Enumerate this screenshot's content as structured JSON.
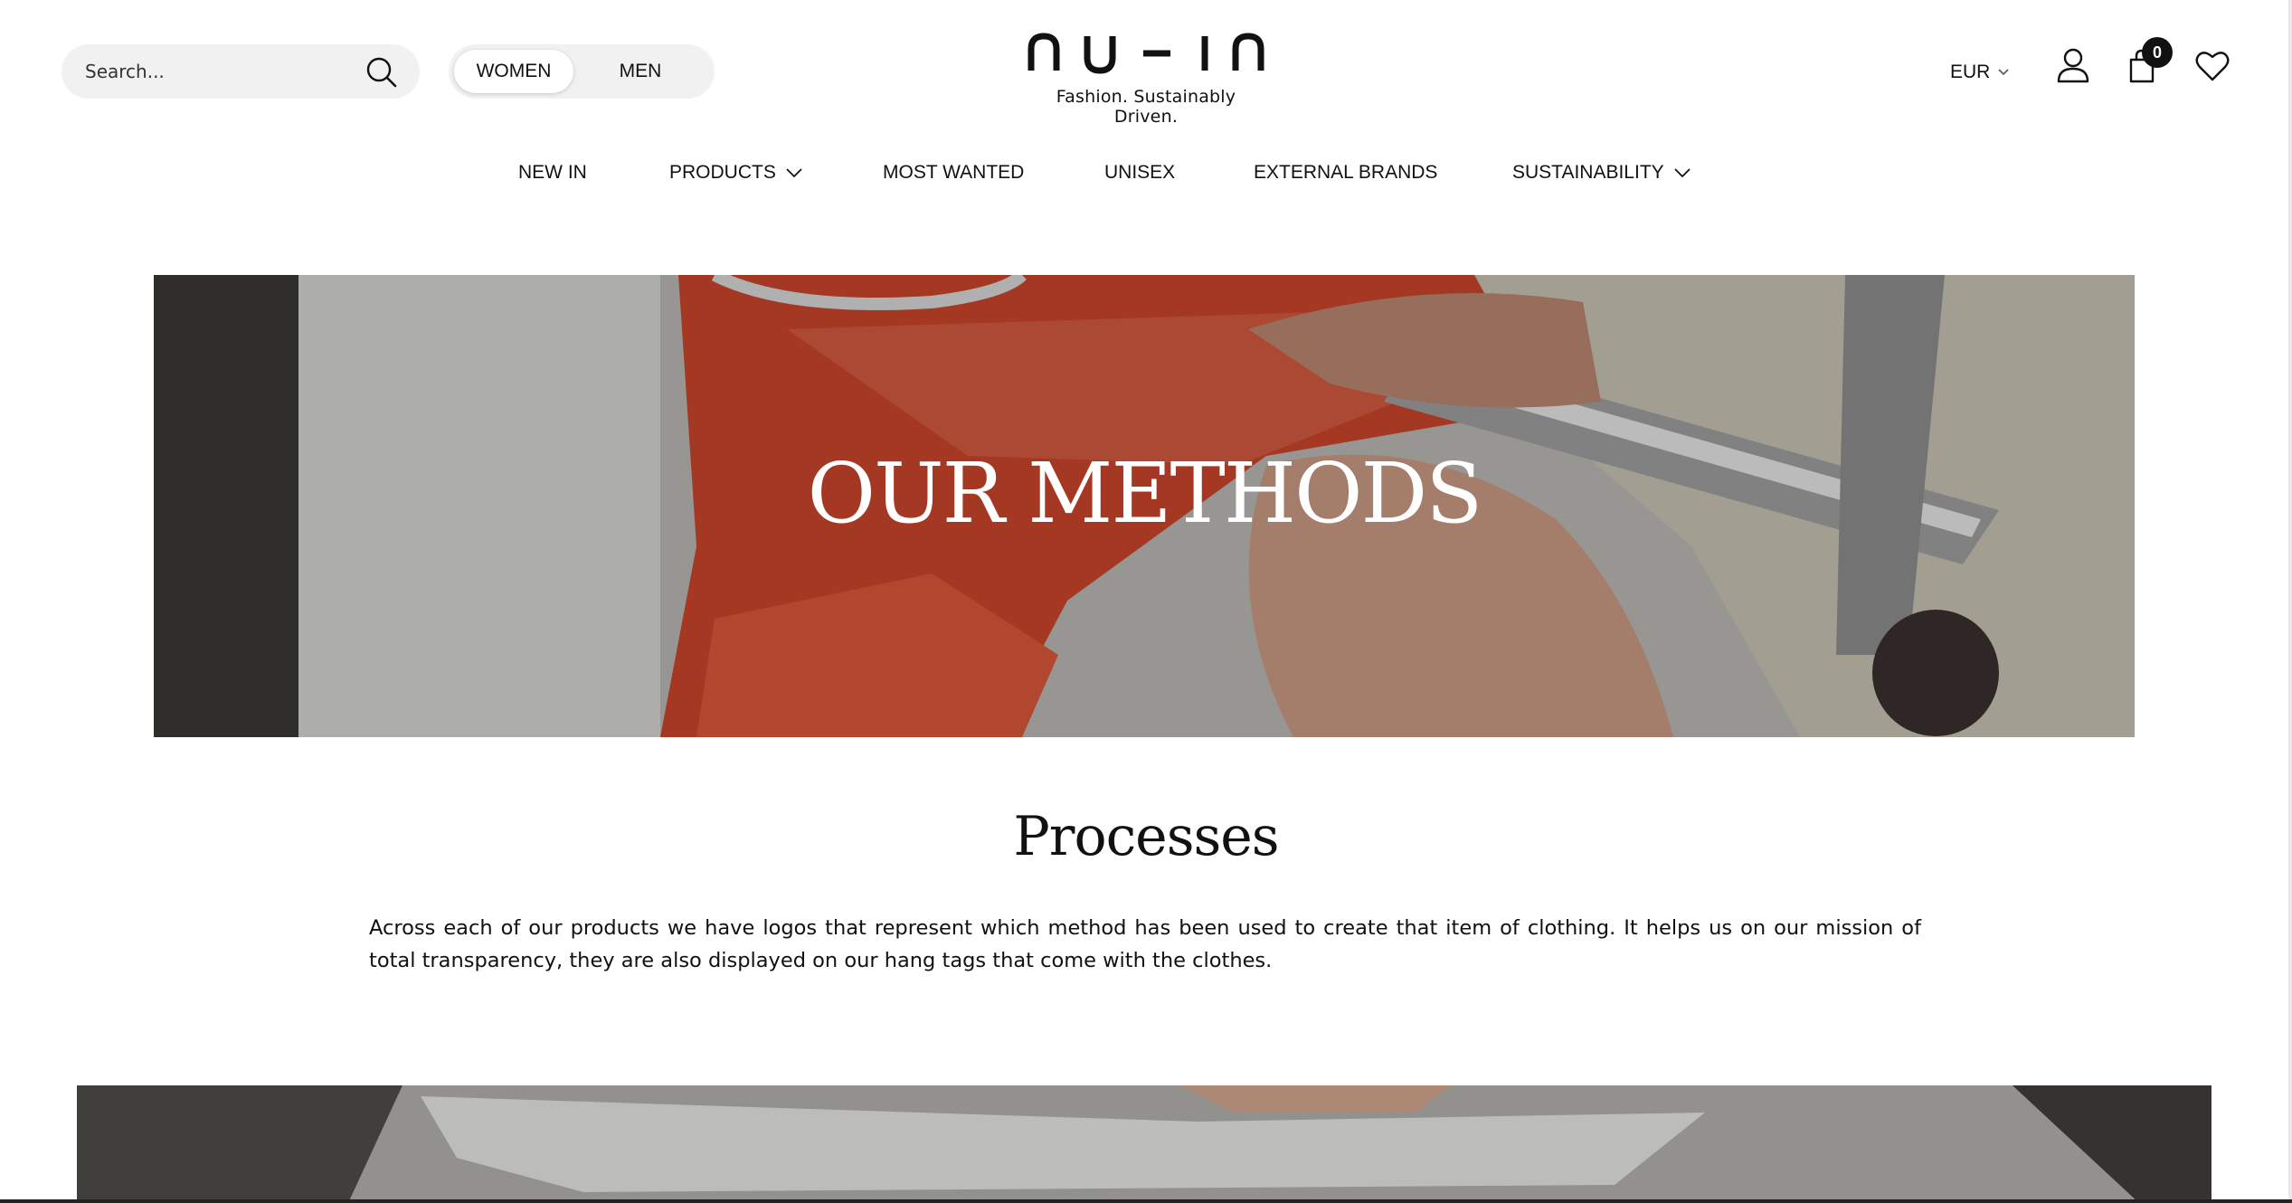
{
  "search": {
    "placeholder": "Search..."
  },
  "gender": {
    "women_label": "WOMEN",
    "men_label": "MEN",
    "selected": "WOMEN"
  },
  "brand": {
    "logo_text": "nu-in",
    "tagline": "Fashion. Sustainably Driven."
  },
  "header": {
    "currency": "EUR",
    "cart_count": "0"
  },
  "nav": {
    "items": [
      {
        "label": "NEW IN",
        "has_dropdown": false
      },
      {
        "label": "PRODUCTS",
        "has_dropdown": true
      },
      {
        "label": "MOST WANTED",
        "has_dropdown": false
      },
      {
        "label": "UNISEX",
        "has_dropdown": false
      },
      {
        "label": "EXTERNAL BRANDS",
        "has_dropdown": false
      },
      {
        "label": "SUSTAINABILITY",
        "has_dropdown": true
      }
    ]
  },
  "hero": {
    "title": "OUR METHODS"
  },
  "processes": {
    "title": "Processes",
    "body": "Across each of our products we have logos that represent which method has been used to create that item of clothing. It helps us on our mission of total transparency, they are also displayed on our hang tags that come with the clothes."
  },
  "colors": {
    "text": "#111111",
    "pill_bg": "#f1f1f1",
    "hero_fabric": "#c8452b"
  }
}
